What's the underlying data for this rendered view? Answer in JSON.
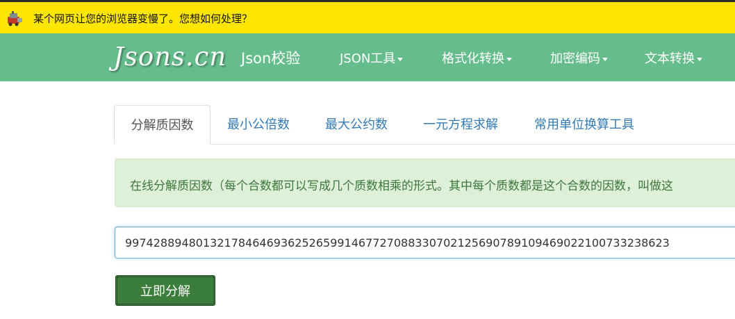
{
  "infobar": {
    "message": "某个网页让您的浏览器变慢了。您想如何处理？"
  },
  "navbar": {
    "brand": "Jsons.cn",
    "items": [
      {
        "label": "Json校验",
        "dropdown": false
      },
      {
        "label": "JSON工具",
        "dropdown": true
      },
      {
        "label": "格式化转换",
        "dropdown": true
      },
      {
        "label": "加密编码",
        "dropdown": true
      },
      {
        "label": "文本转换",
        "dropdown": true
      }
    ]
  },
  "tabs": [
    {
      "label": "分解质因数",
      "active": true
    },
    {
      "label": "最小公倍数",
      "active": false
    },
    {
      "label": "最大公约数",
      "active": false
    },
    {
      "label": "一元方程求解",
      "active": false
    },
    {
      "label": "常用单位换算工具",
      "active": false
    }
  ],
  "alert": {
    "text": "在线分解质因数（每个合数都可以写成几个质数相乘的形式。其中每个质数都是这个合数的因数，叫做这"
  },
  "form": {
    "number_value": "99742889480132178464693625265991467727088330702125690789109469022100733238623",
    "submit_label": "立即分解"
  },
  "colors": {
    "infobar_bg": "#ffe600",
    "navbar_bg": "#66bd8c",
    "alert_bg": "#dff0d8",
    "button_bg": "#3b7d3b",
    "link": "#337ab7"
  }
}
